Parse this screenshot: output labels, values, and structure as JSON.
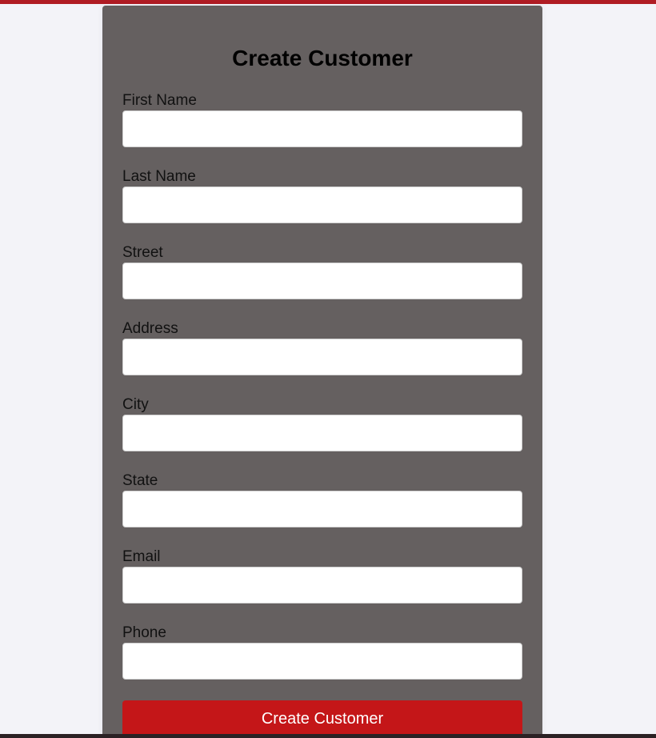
{
  "form": {
    "title": "Create Customer",
    "fields": [
      {
        "label": "First Name",
        "value": "",
        "placeholder": ""
      },
      {
        "label": "Last Name",
        "value": "",
        "placeholder": ""
      },
      {
        "label": "Street",
        "value": "",
        "placeholder": ""
      },
      {
        "label": "Address",
        "value": "",
        "placeholder": ""
      },
      {
        "label": "City",
        "value": "",
        "placeholder": ""
      },
      {
        "label": "State",
        "value": "",
        "placeholder": ""
      },
      {
        "label": "Email",
        "value": "",
        "placeholder": ""
      },
      {
        "label": "Phone",
        "value": "",
        "placeholder": ""
      }
    ],
    "submit_label": "Create Customer"
  },
  "colors": {
    "top_bar": "#b01c24",
    "card_background": "#656060",
    "submit_button": "#c41618",
    "page_background": "#f3f3f8"
  }
}
